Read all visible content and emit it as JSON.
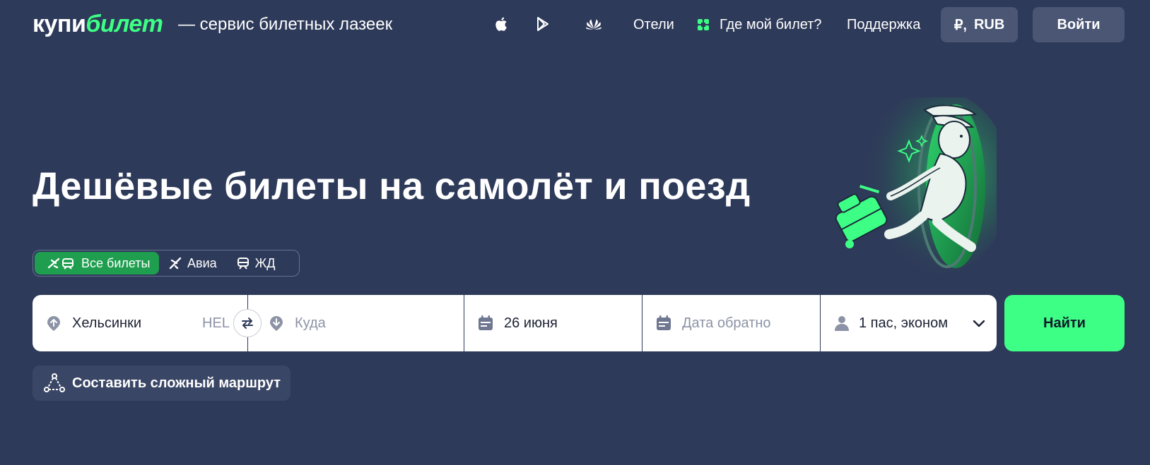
{
  "header": {
    "logo": {
      "part1": "купи",
      "part2": "билет"
    },
    "tagline": "— сервис билетных лазеек",
    "apps": [
      "apple-icon",
      "google-play-icon",
      "huawei-icon"
    ],
    "nav": {
      "hotels": "Отели",
      "where_ticket": "Где мой билет?",
      "support": "Поддержка"
    },
    "currency": {
      "symbol": "₽,",
      "code": "RUB"
    },
    "login": "Войти"
  },
  "hero": {
    "title": "Дешёвые билеты на самолёт и поезд"
  },
  "modes": [
    {
      "label": "Все билеты",
      "active": true,
      "icon": "plane-train-icon"
    },
    {
      "label": "Авиа",
      "active": false,
      "icon": "plane-icon"
    },
    {
      "label": "ЖД",
      "active": false,
      "icon": "train-icon"
    }
  ],
  "search": {
    "from": {
      "value": "Хельсинки",
      "iata": "HEL"
    },
    "to": {
      "placeholder": "Куда"
    },
    "date_there": "26 июня",
    "date_back": {
      "placeholder": "Дата обратно"
    },
    "passengers": "1 пас, эконом",
    "find": "Найти"
  },
  "complex_route": "Составить сложный маршрут",
  "colors": {
    "background": "#2e3a59",
    "accent": "#3dff85",
    "active_tab": "#1f9e4f",
    "header_button": "#4a5674"
  }
}
